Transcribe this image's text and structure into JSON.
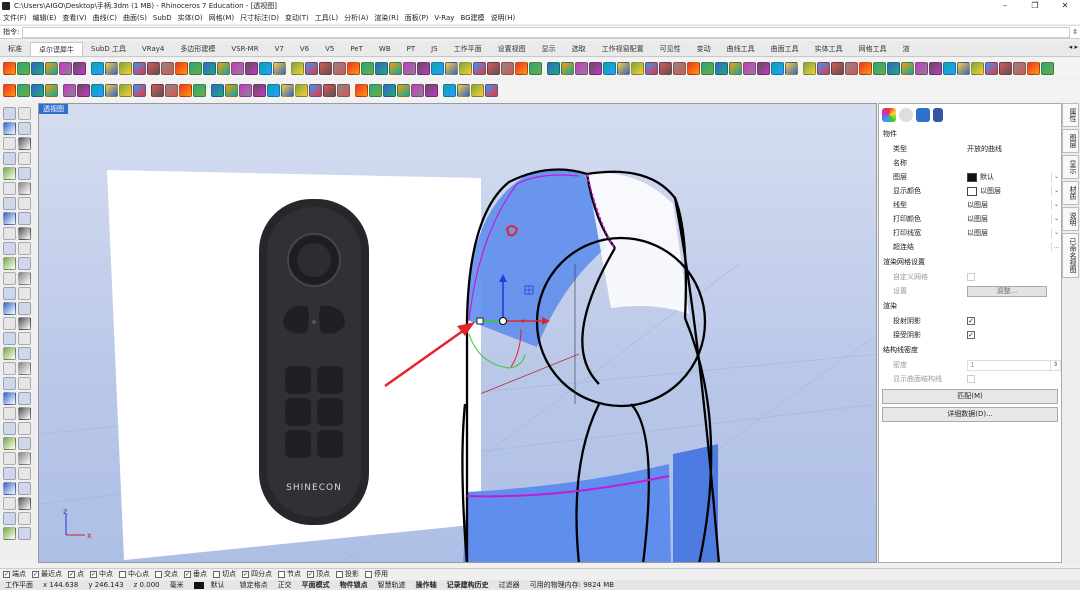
{
  "window": {
    "title": "C:\\Users\\AIGO\\Desktop\\手柄.3dm (1 MB) - Rhinoceros 7 Education - [透视图]",
    "minimize": "–",
    "maximize": "❐",
    "close": "✕"
  },
  "menu": [
    "文件(F)",
    "编辑(E)",
    "查看(V)",
    "曲线(C)",
    "曲面(S)",
    "SubD",
    "实体(O)",
    "网格(M)",
    "尺寸标注(D)",
    "变动(T)",
    "工具(L)",
    "分析(A)",
    "渲染(R)",
    "面板(P)",
    "V-Ray",
    "BG建模",
    "说明(H)"
  ],
  "command": {
    "label": "指令:",
    "value": ""
  },
  "tabs": [
    "标准",
    "卓尔谟犀牛",
    "SubD 工具",
    "VRay4",
    "多边形建模",
    "VSR-MR",
    "V7",
    "V6",
    "V5",
    "PeT",
    "WB",
    "PT",
    "JS",
    "工作平面",
    "设置视图",
    "显示",
    "选取",
    "工作视窗配置",
    "可见性",
    "变动",
    "曲线工具",
    "曲面工具",
    "实体工具",
    "网格工具",
    "渲"
  ],
  "active_tab": "卓尔谟犀牛",
  "viewport": {
    "label": "透视图",
    "logo_text": "SHINECON",
    "axis": {
      "z": "z",
      "x": "x"
    }
  },
  "properties": {
    "section_object": "物件",
    "rows": [
      {
        "key": "类型",
        "value": "开放的曲线"
      },
      {
        "key": "名称",
        "value": ""
      },
      {
        "key": "图层",
        "value": "默认",
        "swatch": "#111111",
        "dropdown": "⌄"
      },
      {
        "key": "显示颜色",
        "value": "以图层",
        "swatch": "#ffffff",
        "dropdown": "⌄"
      },
      {
        "key": "线型",
        "value": "以图层",
        "dropdown": "⌄"
      },
      {
        "key": "打印颜色",
        "value": "以图层",
        "dropdown": "⌄"
      },
      {
        "key": "打印线宽",
        "value": "以图层",
        "dropdown": "⌄"
      },
      {
        "key": "超连结",
        "value": "",
        "dropdown": "..."
      }
    ],
    "section_mesh": "渲染网格设置",
    "mesh_rows": [
      {
        "key": "自定义网格",
        "checked": false,
        "disabled": true
      },
      {
        "key": "设置",
        "button": "调整..."
      }
    ],
    "section_render": "渲染",
    "render_rows": [
      {
        "key": "投射阴影",
        "checked": true
      },
      {
        "key": "接受阴影",
        "checked": true
      }
    ],
    "section_isocurve": "结构线密度",
    "iso_rows": [
      {
        "key": "密度",
        "value": "1"
      },
      {
        "key": "显示曲面结构线",
        "checked": false,
        "disabled": true
      }
    ],
    "match_button": "匹配(M)",
    "details_button": "详细数据(D)..."
  },
  "side_tabs": [
    "属性",
    "图层",
    "显示",
    "材质",
    "说明",
    "已命名视图"
  ],
  "osnap": [
    {
      "label": "端点",
      "checked": true
    },
    {
      "label": "最近点",
      "checked": true
    },
    {
      "label": "点",
      "checked": true
    },
    {
      "label": "中点",
      "checked": true
    },
    {
      "label": "中心点",
      "checked": false
    },
    {
      "label": "交点",
      "checked": false
    },
    {
      "label": "垂点",
      "checked": true
    },
    {
      "label": "切点",
      "checked": false
    },
    {
      "label": "四分点",
      "checked": true
    },
    {
      "label": "节点",
      "checked": false
    },
    {
      "label": "顶点",
      "checked": true
    },
    {
      "label": "投影",
      "checked": false
    },
    {
      "label": "停用",
      "checked": false
    }
  ],
  "status": {
    "cplane": "工作平面",
    "x": "x 144.638",
    "y": "y 246.143",
    "z": "z 0.000",
    "units": "毫米",
    "layer": "默认",
    "grid_snap": "锁定格点",
    "ortho": "正交",
    "planar": "平面模式",
    "osnap": "物件锁点",
    "smarttrack": "智慧轨迹",
    "gumball": "操作轴",
    "history": "记录建构历史",
    "filter": "过滤器",
    "memory": "可用的物理内存: 9824 MB"
  },
  "colors": {
    "surface_blue": "#5f8eec",
    "selection_magenta": "#c41bd8",
    "arrow_red": "#e3252b",
    "viewport_tab": "#2f6fcf"
  }
}
